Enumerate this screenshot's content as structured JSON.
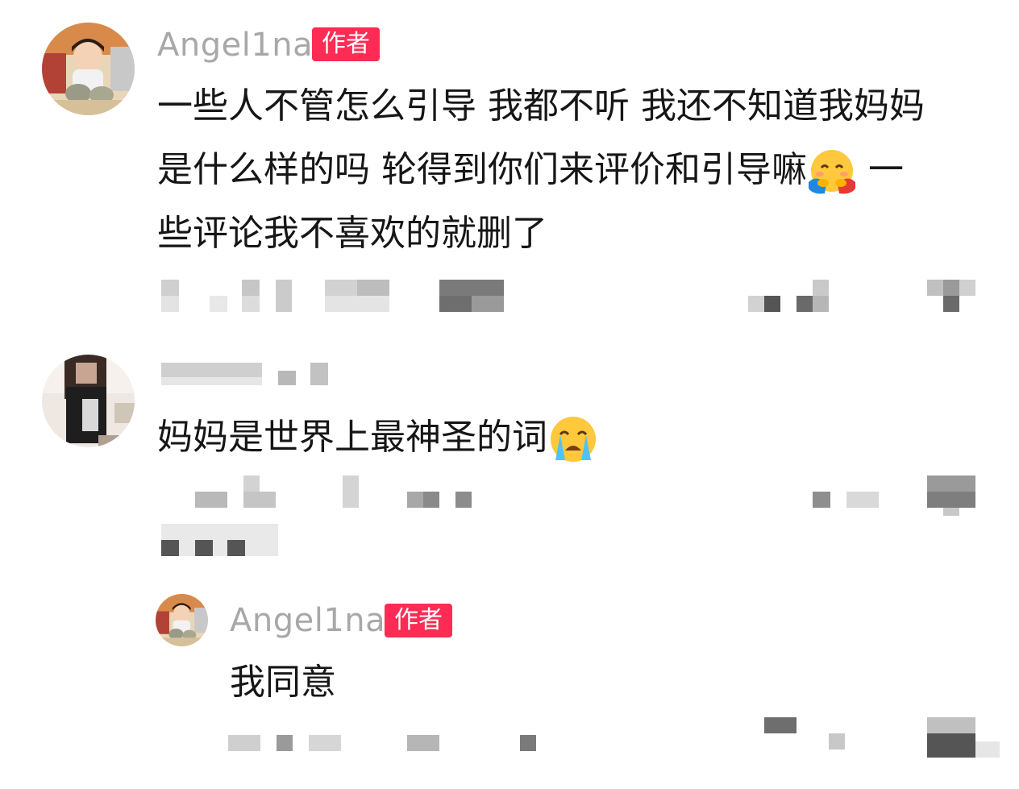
{
  "comments": [
    {
      "username": "Angel1na",
      "badge": "作者",
      "lines": [
        "一些人不管怎么引导 我都不听 我还不知道我妈妈",
        "是什么样的吗 轮得到你们来评价和引导嘛",
        " 一",
        "些评论我不喜欢的就删了"
      ],
      "emoji": "hugging-face-emoji"
    },
    {
      "text": "妈妈是世界上最神圣的词",
      "emoji": "loudly-crying-face-emoji"
    },
    {
      "username": "Angel1na",
      "badge": "作者",
      "text": "我同意"
    }
  ],
  "colors": {
    "badge": "#fe2c55",
    "username": "#a8a8a8",
    "text": "#161616"
  }
}
